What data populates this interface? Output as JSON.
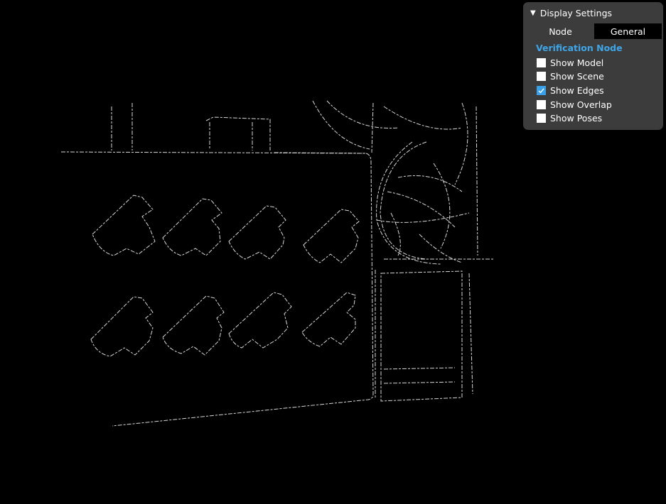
{
  "colors": {
    "background": "#000000",
    "edge_stroke": "#d8d8d8",
    "panel_bg": "#3c3c3c",
    "accent": "#3ea6e8",
    "checkbox_checked": "#3aa0e8"
  },
  "viewport": {
    "description": "Edge-detection render (white edges on black) of a tray with 8 T-shaped parts and cable bundle"
  },
  "display_settings": {
    "header_icon": "triangle-down-icon",
    "header_glyph": "▼",
    "title": "Display Settings",
    "tabs": [
      {
        "label": "Node",
        "active": false
      },
      {
        "label": "General",
        "active": true
      }
    ],
    "section_title": "Verification Node",
    "options": [
      {
        "label": "Show Model",
        "checked": false
      },
      {
        "label": "Show Scene",
        "checked": false
      },
      {
        "label": "Show Edges",
        "checked": true
      },
      {
        "label": "Show Overlap",
        "checked": false
      },
      {
        "label": "Show Poses",
        "checked": false
      }
    ]
  }
}
